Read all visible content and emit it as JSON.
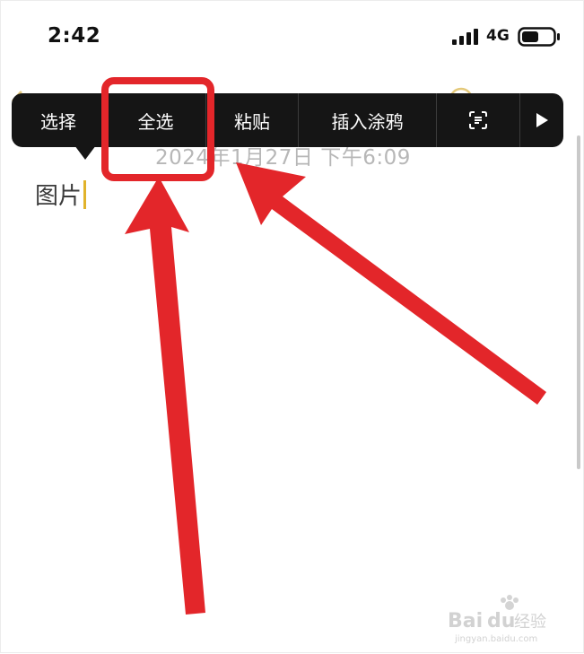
{
  "status_bar": {
    "time": "2:42",
    "network": "4G"
  },
  "note": {
    "date": "2024年1月27日 下午6:09",
    "body": "图片"
  },
  "context_menu": {
    "items": [
      {
        "label": "选择"
      },
      {
        "label": "全选"
      },
      {
        "label": "粘贴"
      },
      {
        "label": "插入涂鸦"
      },
      {
        "label": "",
        "icon": "scan-text-icon"
      },
      {
        "label": "",
        "icon": "play-arrow-icon"
      }
    ]
  },
  "annotations": {
    "highlight_color": "#e3262a"
  },
  "watermark": {
    "text": "Baidu经验",
    "subtext": "jingyan.baidu.com"
  }
}
